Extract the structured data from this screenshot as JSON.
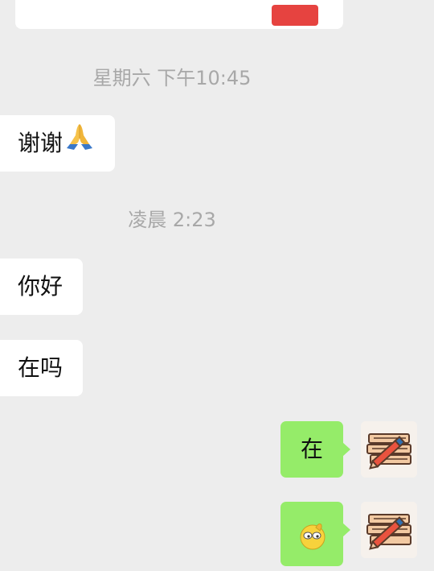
{
  "chat": {
    "timestamps": {
      "t1": "星期六 下午10:45",
      "t2": "凌晨 2:23"
    },
    "messages": {
      "m1": "谢谢",
      "m1_emoji": "folded-hands-emoji",
      "m2": "你好",
      "m3": "在吗",
      "m4": "在",
      "m5_emoji": "thinking-face-emoji"
    },
    "colors": {
      "background": "#ededed",
      "incoming_bubble": "#ffffff",
      "outgoing_bubble": "#95ec69",
      "timestamp_text": "#a8a8a8",
      "card_button": "#e64340"
    },
    "icons": {
      "avatar": "books-and-pencil-avatar"
    }
  }
}
